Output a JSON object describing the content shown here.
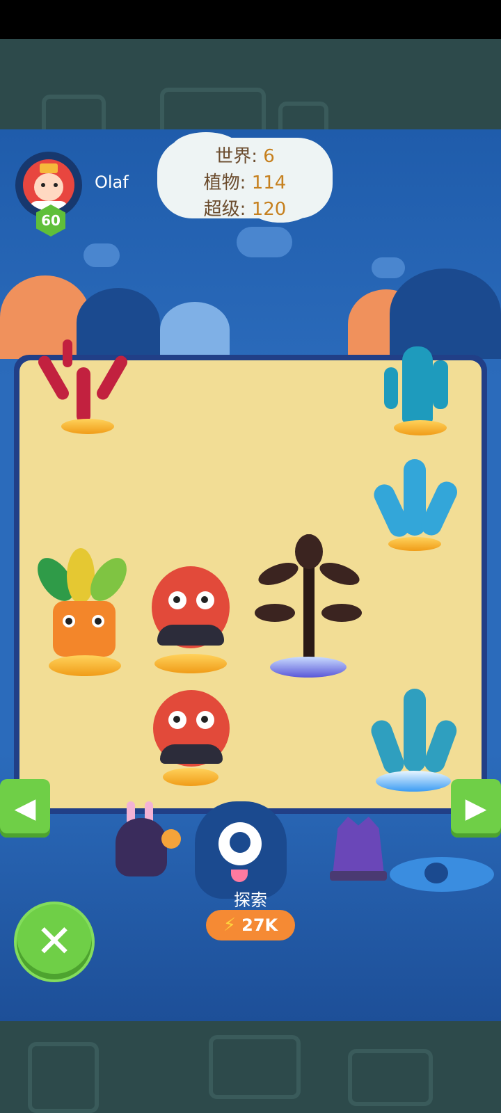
{
  "player": {
    "name": "Olaf",
    "level": "60"
  },
  "stats": {
    "world_label": "世界:",
    "world_value": "6",
    "plants_label": "植物:",
    "plants_value": "114",
    "super_label": "超级:",
    "super_value": "120"
  },
  "explore": {
    "label": "探索",
    "cost": "27K",
    "cost_icon": "lightning-icon"
  },
  "controls": {
    "left_arrow": "◀",
    "right_arrow": "▶",
    "close": "✕"
  },
  "colors": {
    "panel_blue": "#2b6bbb",
    "sand": "#f2dd95",
    "button_green": "#6fcf47",
    "cost_orange": "#f58a34"
  }
}
